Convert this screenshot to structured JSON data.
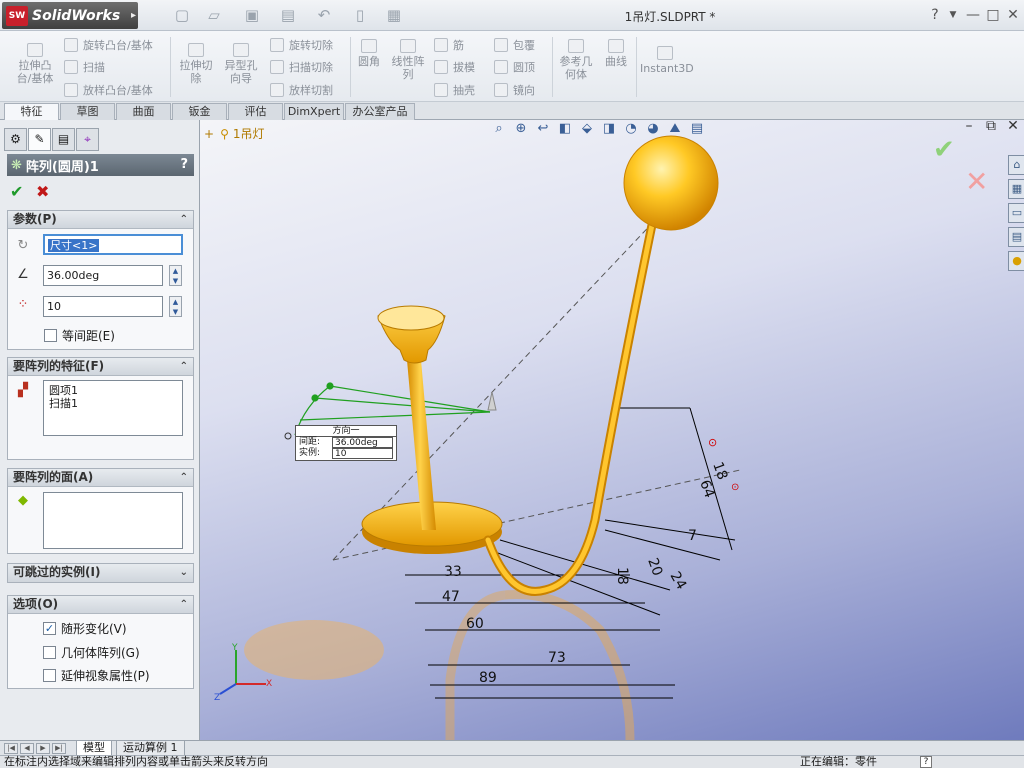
{
  "app": {
    "logo_badge": "SW",
    "logo_text": "SolidWorks",
    "document_title": "1吊灯.SLDPRT *",
    "help_icon": "?"
  },
  "command_manager": {
    "extrude_boss": "拉伸凸\n台/基体",
    "revolve_boss": "旋转凸台/基体",
    "sweep": "扫描",
    "loft_boss": "放样凸台/基体",
    "extrude_cut": "拉伸切\n除",
    "hole_wizard": "异型孔\n向导",
    "revolve_cut": "旋转切除",
    "sweep_cut": "扫描切除",
    "loft_cut": "放样切割",
    "fillet": "圆角",
    "linear_pattern": "线性阵\n列",
    "rib": "筋",
    "draft": "拔模",
    "shell": "抽壳",
    "wrap": "包覆",
    "dome": "圆顶",
    "mirror": "镜向",
    "ref_geometry": "参考几\n何体",
    "curves": "曲线",
    "instant3d": "Instant3D"
  },
  "tabs": [
    "特征",
    "草图",
    "曲面",
    "钣金",
    "评估",
    "DimXpert",
    "办公室产品"
  ],
  "property_manager": {
    "title": "阵列(圆周)1",
    "help": "?",
    "parameters": {
      "header": "参数(P)",
      "axis_value": "尺寸<1>",
      "angle_value": "36.00deg",
      "instances_value": "10",
      "equal_spacing_label": "等间距(E)"
    },
    "features_to_pattern": {
      "header": "要阵列的特征(F)",
      "items": [
        "圆项1",
        "扫描1"
      ]
    },
    "faces_to_pattern": {
      "header": "要阵列的面(A)"
    },
    "instances_to_skip": {
      "header": "可跳过的实例(I)"
    },
    "options": {
      "header": "选项(O)",
      "geometry_follow_label": "随形变化(V)",
      "geometry_pattern_label": "几何体阵列(G)",
      "propagate_visual_label": "延伸视象属性(P)"
    }
  },
  "viewport": {
    "tree_root": "1吊灯",
    "callout": {
      "header": "方向一",
      "spacing_label": "间距:",
      "spacing_value": "36.00deg",
      "instances_label": "实例:",
      "instances_value": "10"
    },
    "dimensions": [
      "33",
      "47",
      "60",
      "73",
      "89",
      "18",
      "20",
      "24",
      "7",
      "18",
      "64"
    ]
  },
  "bottom_tabs": [
    "模型",
    "运动算例 1"
  ],
  "status": {
    "message": "在标注内选择域来编辑排列内容或单击箭头来反转方向",
    "editing": "正在编辑：零件",
    "help": "?"
  },
  "colors": {
    "part_yellow": "#f5b300",
    "part_highlight": "#ffd84d",
    "dimension_line": "#000000",
    "sketch_green": "#20a020",
    "accept_green": "#1f9a2b",
    "cancel_red": "#c01818"
  }
}
